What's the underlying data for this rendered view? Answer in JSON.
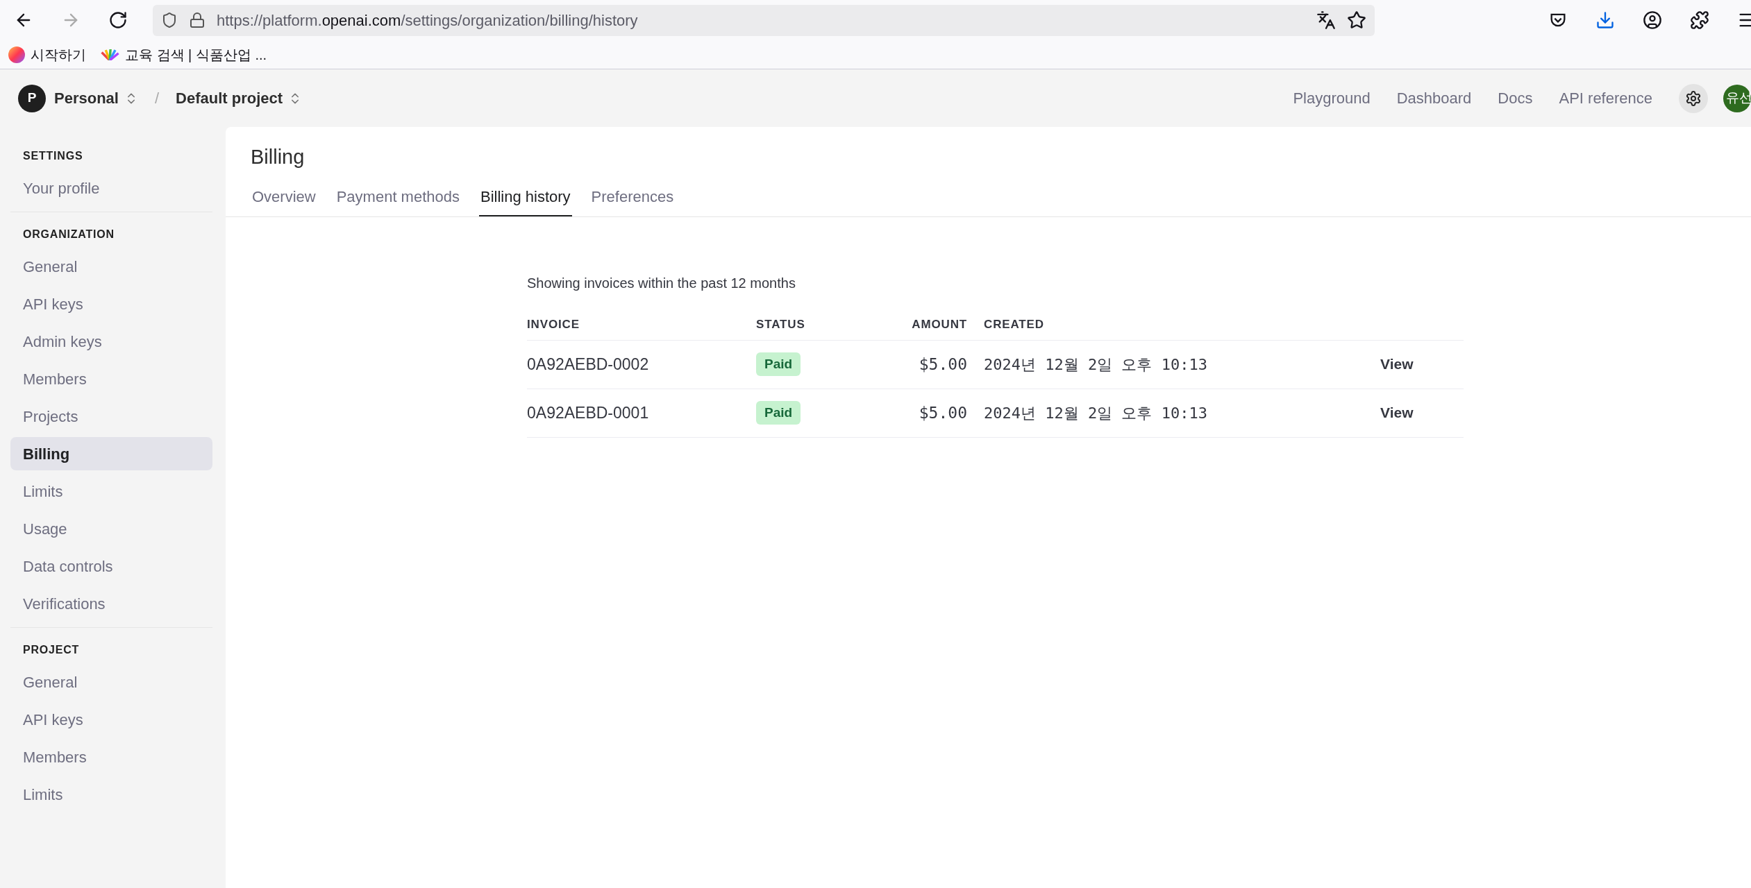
{
  "browser": {
    "url_prefix": "https://platform.",
    "url_domain": "openai.com",
    "url_path": "/settings/organization/billing/history",
    "bookmarks": [
      "시작하기",
      "교육 검색 | 식품산업 ..."
    ]
  },
  "header": {
    "org_initial": "P",
    "org": "Personal",
    "separator": "/",
    "project": "Default project",
    "links": [
      "Playground",
      "Dashboard",
      "Docs",
      "API reference"
    ],
    "avatar": "유선"
  },
  "sidebar": {
    "sections": [
      {
        "title": "SETTINGS",
        "items": [
          {
            "label": "Your profile",
            "selected": false
          }
        ]
      },
      {
        "title": "ORGANIZATION",
        "items": [
          {
            "label": "General",
            "selected": false
          },
          {
            "label": "API keys",
            "selected": false
          },
          {
            "label": "Admin keys",
            "selected": false
          },
          {
            "label": "Members",
            "selected": false
          },
          {
            "label": "Projects",
            "selected": false
          },
          {
            "label": "Billing",
            "selected": true
          },
          {
            "label": "Limits",
            "selected": false
          },
          {
            "label": "Usage",
            "selected": false
          },
          {
            "label": "Data controls",
            "selected": false
          },
          {
            "label": "Verifications",
            "selected": false
          }
        ]
      },
      {
        "title": "PROJECT",
        "items": [
          {
            "label": "General",
            "selected": false
          },
          {
            "label": "API keys",
            "selected": false
          },
          {
            "label": "Members",
            "selected": false
          },
          {
            "label": "Limits",
            "selected": false
          }
        ]
      }
    ]
  },
  "page": {
    "title": "Billing",
    "tabs": [
      {
        "label": "Overview",
        "selected": false
      },
      {
        "label": "Payment methods",
        "selected": false
      },
      {
        "label": "Billing history",
        "selected": true
      },
      {
        "label": "Preferences",
        "selected": false
      }
    ],
    "note": "Showing invoices within the past 12 months",
    "table": {
      "columns": [
        "INVOICE",
        "STATUS",
        "AMOUNT",
        "CREATED"
      ],
      "rows": [
        {
          "invoice": "0A92AEBD-0002",
          "status": "Paid",
          "amount": "$5.00",
          "created": "2024년 12월 2일 오후 10:13",
          "action": "View"
        },
        {
          "invoice": "0A92AEBD-0001",
          "status": "Paid",
          "amount": "$5.00",
          "created": "2024년 12월 2일 오후 10:13",
          "action": "View"
        }
      ]
    }
  }
}
